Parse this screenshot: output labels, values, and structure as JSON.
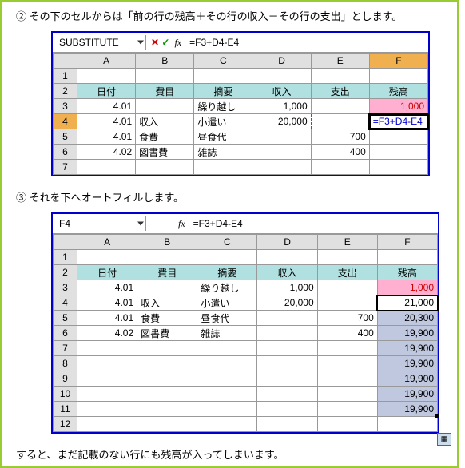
{
  "steps": {
    "step2": "② その下のセルからは「前の行の残高＋その行の収入－その行の支出」とします。",
    "step3": "③ それを下へオートフィルします。",
    "step4": "すると、まだ記載のない行にも残高が入ってしまいます。"
  },
  "shot1": {
    "namebox": "SUBSTITUTE",
    "fx": "fx",
    "formula": "=F3+D4-E4",
    "cols": [
      "A",
      "B",
      "C",
      "D",
      "E",
      "F"
    ],
    "rows": [
      "1",
      "2",
      "3",
      "4",
      "5",
      "6",
      "7"
    ],
    "headers": {
      "A": "日付",
      "B": "費目",
      "C": "摘要",
      "D": "収入",
      "E": "支出",
      "F": "残高"
    },
    "data": [
      {
        "A": "4.01",
        "B": "",
        "C": "繰り越し",
        "D": "1,000",
        "E": "",
        "F": "1,000"
      },
      {
        "A": "4.01",
        "B": "収入",
        "C": "小遣い",
        "D": "20,000",
        "E": "",
        "F": "=F3+D4-E4"
      },
      {
        "A": "4.01",
        "B": "食費",
        "C": "昼食代",
        "D": "",
        "E": "700",
        "F": ""
      },
      {
        "A": "4.02",
        "B": "図書費",
        "C": "雑誌",
        "D": "",
        "E": "400",
        "F": ""
      }
    ]
  },
  "shot2": {
    "namebox": "F4",
    "fx": "fx",
    "formula": "=F3+D4-E4",
    "cols": [
      "A",
      "B",
      "C",
      "D",
      "E",
      "F"
    ],
    "rows": [
      "1",
      "2",
      "3",
      "4",
      "5",
      "6",
      "7",
      "8",
      "9",
      "10",
      "11",
      "12"
    ],
    "headers": {
      "A": "日付",
      "B": "費目",
      "C": "摘要",
      "D": "収入",
      "E": "支出",
      "F": "残高"
    },
    "data": [
      {
        "A": "4.01",
        "B": "",
        "C": "繰り越し",
        "D": "1,000",
        "E": "",
        "F": "1,000"
      },
      {
        "A": "4.01",
        "B": "収入",
        "C": "小遣い",
        "D": "20,000",
        "E": "",
        "F": "21,000"
      },
      {
        "A": "4.01",
        "B": "食費",
        "C": "昼食代",
        "D": "",
        "E": "700",
        "F": "20,300"
      },
      {
        "A": "4.02",
        "B": "図書費",
        "C": "雑誌",
        "D": "",
        "E": "400",
        "F": "19,900"
      },
      {
        "A": "",
        "B": "",
        "C": "",
        "D": "",
        "E": "",
        "F": "19,900"
      },
      {
        "A": "",
        "B": "",
        "C": "",
        "D": "",
        "E": "",
        "F": "19,900"
      },
      {
        "A": "",
        "B": "",
        "C": "",
        "D": "",
        "E": "",
        "F": "19,900"
      },
      {
        "A": "",
        "B": "",
        "C": "",
        "D": "",
        "E": "",
        "F": "19,900"
      },
      {
        "A": "",
        "B": "",
        "C": "",
        "D": "",
        "E": "",
        "F": "19,900"
      }
    ]
  }
}
